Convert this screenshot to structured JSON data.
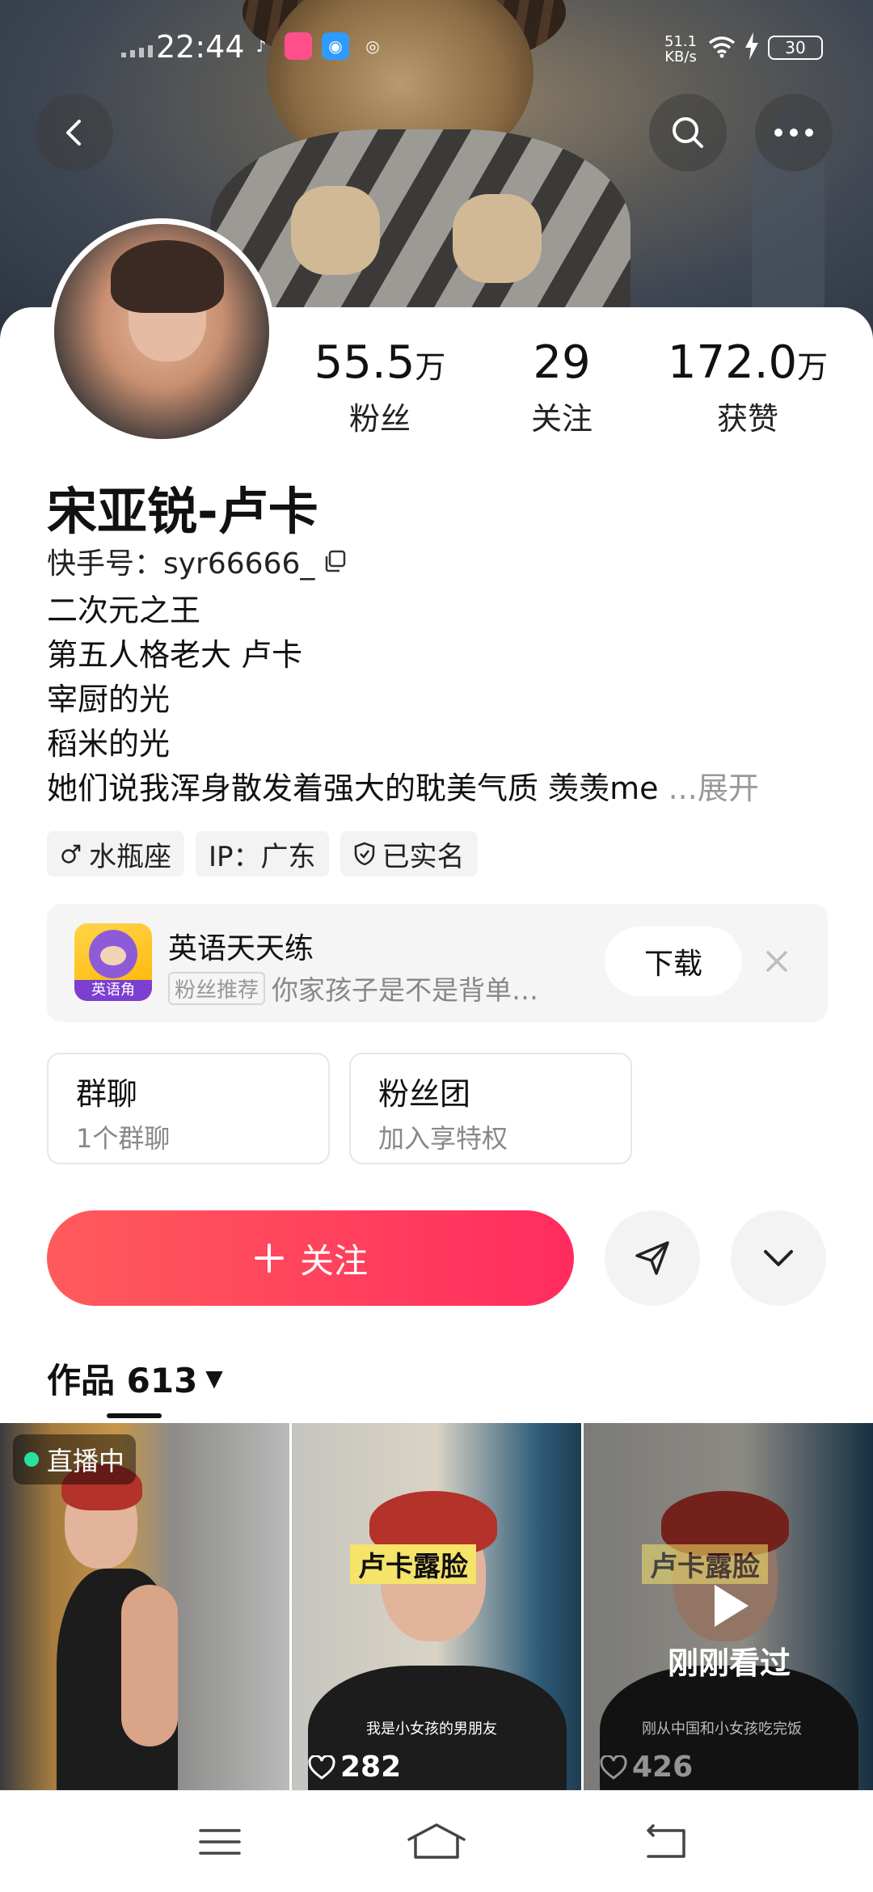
{
  "status_bar": {
    "time": "22:44",
    "net_speed_value": "51.1",
    "net_speed_unit": "KB/s",
    "battery": "30"
  },
  "header": {
    "back_icon": "chevron-left-icon",
    "search_icon": "search-icon",
    "more_icon": "more-horizontal-icon"
  },
  "profile": {
    "name": "宋亚锐-卢卡",
    "kuaishou_id": "快手号：syr66666_",
    "stats": [
      {
        "value": "55.5",
        "unit": "万",
        "label": "粉丝"
      },
      {
        "value": "29",
        "unit": "",
        "label": "关注"
      },
      {
        "value": "172.0",
        "unit": "万",
        "label": "获赞"
      }
    ],
    "bio_lines": [
      "二次元之王",
      "第五人格老大 卢卡",
      "宰厨的光",
      "稻米的光",
      "她们说我浑身散发着强大的耽美气质 羡羡me"
    ],
    "bio_more": "...展开",
    "tags": [
      "水瓶座",
      "IP：广东",
      "已实名"
    ]
  },
  "ad": {
    "title": "英语天天练",
    "badge": "粉丝推荐",
    "text": "你家孩子是不是背单…",
    "logo_text": "英语角",
    "download_label": "下载"
  },
  "group_cards": [
    {
      "title": "群聊",
      "subtitle": "1个群聊"
    },
    {
      "title": "粉丝团",
      "subtitle": "加入享特权"
    }
  ],
  "actions": {
    "follow_label": "关注",
    "follow_color_start": "#ff5b5b",
    "follow_color_end": "#ff2c5f"
  },
  "works": {
    "tab_label": "作品 613",
    "items": [
      {
        "badge": "直播中"
      },
      {
        "caption": "卢卡露脸",
        "subcaption": "我是小女孩的男朋友",
        "likes": "282"
      },
      {
        "caption": "卢卡露脸",
        "subcaption": "刚从中国和小女孩吃完饭",
        "likes": "426",
        "overlay": "刚刚看过"
      }
    ]
  }
}
